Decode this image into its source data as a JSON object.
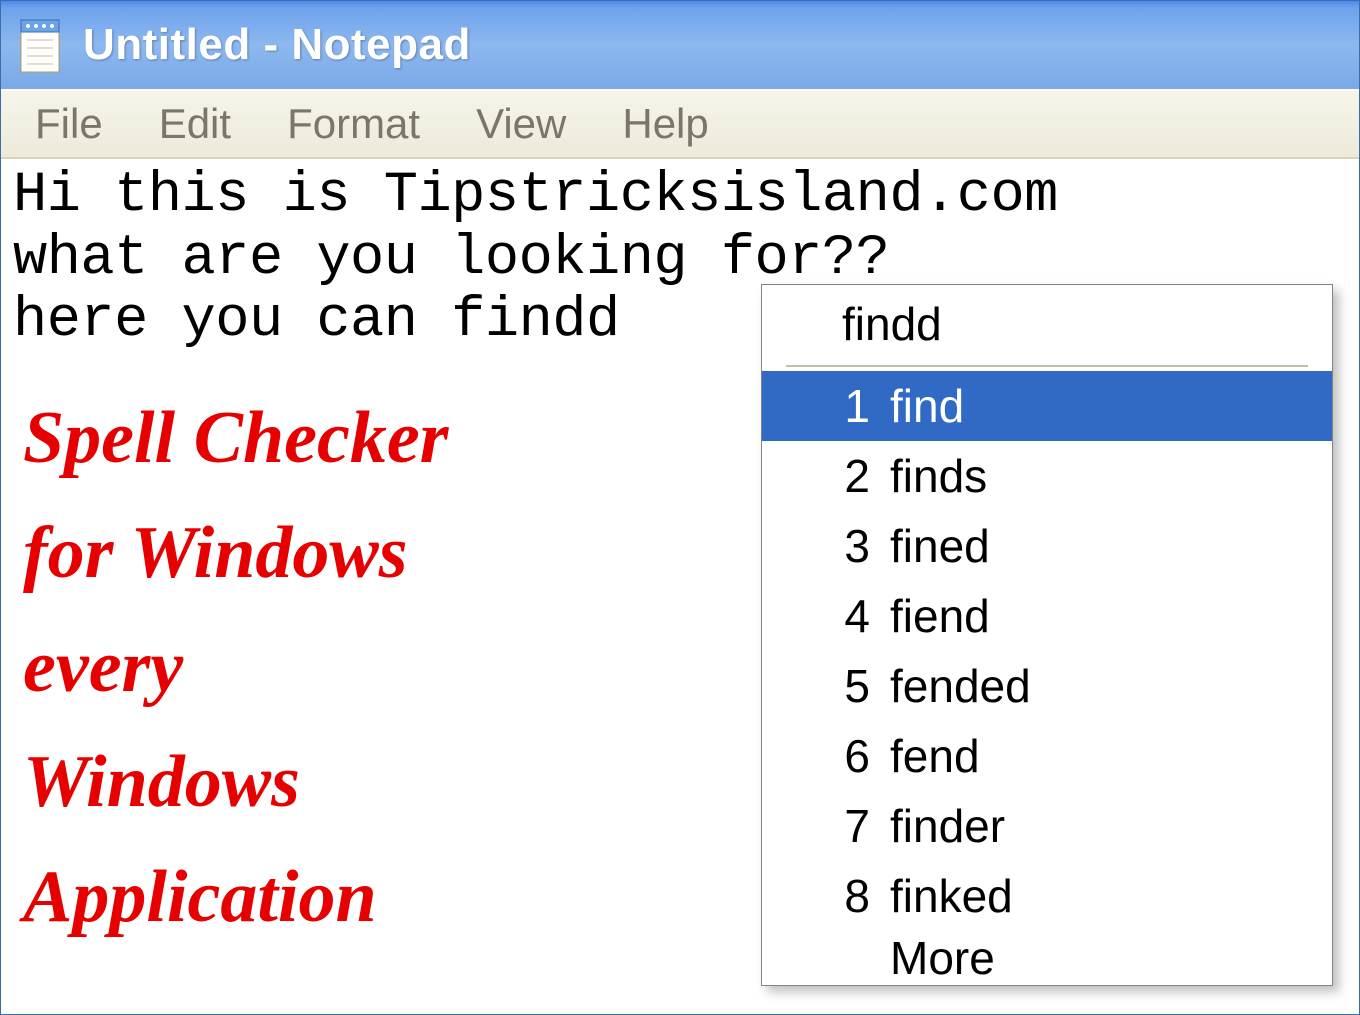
{
  "window": {
    "title": "Untitled - Notepad"
  },
  "menubar": {
    "items": [
      "File",
      "Edit",
      "Format",
      "View",
      "Help"
    ]
  },
  "editor": {
    "line1": "Hi this is Tipstricksisland.com",
    "line2": "what are you looking for??",
    "line3": "here you can findd"
  },
  "overlay": {
    "text": "Spell Checker\nfor Windows\nevery\nWindows\nApplication"
  },
  "spell": {
    "query": "findd",
    "suggestions": [
      {
        "n": "1",
        "word": "find",
        "selected": true
      },
      {
        "n": "2",
        "word": "finds",
        "selected": false
      },
      {
        "n": "3",
        "word": "fined",
        "selected": false
      },
      {
        "n": "4",
        "word": "fiend",
        "selected": false
      },
      {
        "n": "5",
        "word": "fended",
        "selected": false
      },
      {
        "n": "6",
        "word": "fend",
        "selected": false
      },
      {
        "n": "7",
        "word": "finder",
        "selected": false
      },
      {
        "n": "8",
        "word": "finked",
        "selected": false
      }
    ],
    "more": "More"
  }
}
